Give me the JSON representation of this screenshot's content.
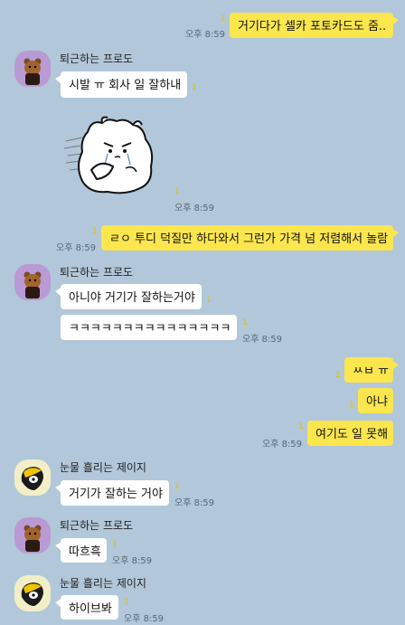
{
  "messages": {
    "m1": {
      "text": "거기다가 셀카 포토카드도 줌..",
      "time": "오후 8:59",
      "unread": "1"
    },
    "m2": {
      "sender": "퇴근하는 프로도",
      "text": "시발 ㅠ 회사 일 잘하내",
      "unread": "1"
    },
    "m3": {
      "time": "오후 8:59",
      "unread": "1"
    },
    "m4": {
      "text": "ㄹㅇ 투디 덕질만 하다와서 그런가 가격 넘 저렴해서 놀람",
      "time": "오후 8:59",
      "unread": "1"
    },
    "m5": {
      "sender": "퇴근하는 프로도",
      "text": "아니야 거기가 잘하는거야",
      "unread": "1"
    },
    "m6": {
      "text": "ㅋㅋㅋㅋㅋㅋㅋㅋㅋㅋㅋㅋㅋㅋㅋ",
      "time": "오후 8:59",
      "unread": "1"
    },
    "m7": {
      "text": "ㅆㅂ ㅠ",
      "unread": "1"
    },
    "m8": {
      "text": "아냐",
      "unread": "1"
    },
    "m9": {
      "text": "여기도 일 못해",
      "time": "오후 8:59",
      "unread": "1"
    },
    "m10": {
      "sender": "눈물 흘리는 제이지",
      "text": "거기가 잘하는 거야",
      "time": "오후 8:59",
      "unread": "1"
    },
    "m11": {
      "sender": "퇴근하는 프로도",
      "text": "따흐흑",
      "time": "오후 8:59",
      "unread": "1"
    },
    "m12": {
      "sender": "눈물 흘리는 제이지",
      "text": "하이브봐",
      "time": "오후 8:59",
      "unread": "1"
    }
  },
  "icons": {
    "frodo_avatar": "frodo-avatar-icon",
    "jayg_avatar": "jay-g-avatar-icon",
    "sticker": "crying-bear-sticker"
  },
  "colors": {
    "background": "#b2c7d9",
    "my_bubble": "#fbe64d",
    "their_bubble": "#ffffff",
    "unread": "#e5c100"
  }
}
